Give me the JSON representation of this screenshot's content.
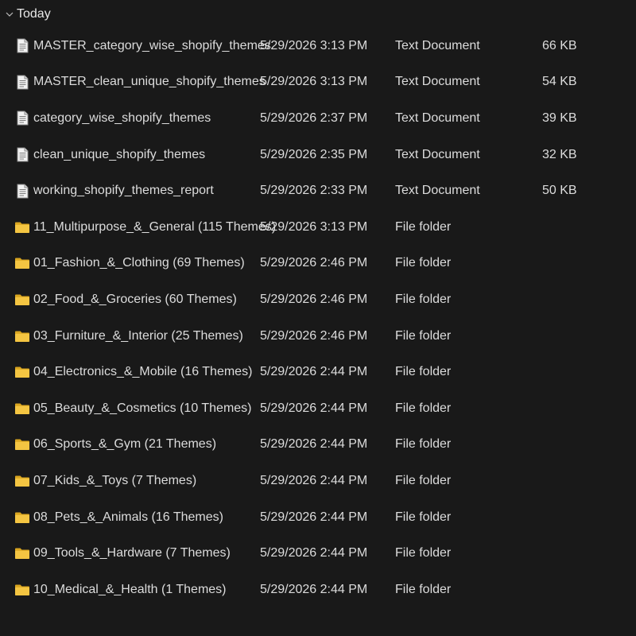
{
  "group": {
    "title": "Today"
  },
  "files": [
    {
      "name": "MASTER_category_wise_shopify_themes",
      "date": "5/29/2026 3:13 PM",
      "type": "Text Document",
      "size": "66 KB",
      "icon": "text-document-icon"
    },
    {
      "name": "MASTER_clean_unique_shopify_themes",
      "date": "5/29/2026 3:13 PM",
      "type": "Text Document",
      "size": "54 KB",
      "icon": "text-document-icon"
    },
    {
      "name": "category_wise_shopify_themes",
      "date": "5/29/2026 2:37 PM",
      "type": "Text Document",
      "size": "39 KB",
      "icon": "text-document-icon"
    },
    {
      "name": "clean_unique_shopify_themes",
      "date": "5/29/2026 2:35 PM",
      "type": "Text Document",
      "size": "32 KB",
      "icon": "text-document-icon"
    },
    {
      "name": "working_shopify_themes_report",
      "date": "5/29/2026 2:33 PM",
      "type": "Text Document",
      "size": "50 KB",
      "icon": "text-document-icon"
    },
    {
      "name": "11_Multipurpose_&_General (115 Themes)",
      "date": "5/29/2026 3:13 PM",
      "type": "File folder",
      "size": "",
      "icon": "folder-icon"
    },
    {
      "name": "01_Fashion_&_Clothing (69 Themes)",
      "date": "5/29/2026 2:46 PM",
      "type": "File folder",
      "size": "",
      "icon": "folder-icon"
    },
    {
      "name": "02_Food_&_Groceries (60 Themes)",
      "date": "5/29/2026 2:46 PM",
      "type": "File folder",
      "size": "",
      "icon": "folder-icon"
    },
    {
      "name": "03_Furniture_&_Interior (25 Themes)",
      "date": "5/29/2026 2:46 PM",
      "type": "File folder",
      "size": "",
      "icon": "folder-icon"
    },
    {
      "name": "04_Electronics_&_Mobile (16 Themes)",
      "date": "5/29/2026 2:44 PM",
      "type": "File folder",
      "size": "",
      "icon": "folder-icon"
    },
    {
      "name": "05_Beauty_&_Cosmetics (10 Themes)",
      "date": "5/29/2026 2:44 PM",
      "type": "File folder",
      "size": "",
      "icon": "folder-icon"
    },
    {
      "name": "06_Sports_&_Gym (21 Themes)",
      "date": "5/29/2026 2:44 PM",
      "type": "File folder",
      "size": "",
      "icon": "folder-icon"
    },
    {
      "name": "07_Kids_&_Toys (7 Themes)",
      "date": "5/29/2026 2:44 PM",
      "type": "File folder",
      "size": "",
      "icon": "folder-icon"
    },
    {
      "name": "08_Pets_&_Animals (16 Themes)",
      "date": "5/29/2026 2:44 PM",
      "type": "File folder",
      "size": "",
      "icon": "folder-icon"
    },
    {
      "name": "09_Tools_&_Hardware (7 Themes)",
      "date": "5/29/2026 2:44 PM",
      "type": "File folder",
      "size": "",
      "icon": "folder-icon"
    },
    {
      "name": "10_Medical_&_Health (1 Themes)",
      "date": "5/29/2026 2:44 PM",
      "type": "File folder",
      "size": "",
      "icon": "folder-icon"
    }
  ],
  "colors": {
    "background": "#191919",
    "text": "#dcdcdc",
    "folder": "#f4c542",
    "folder_dark": "#d9a520"
  }
}
